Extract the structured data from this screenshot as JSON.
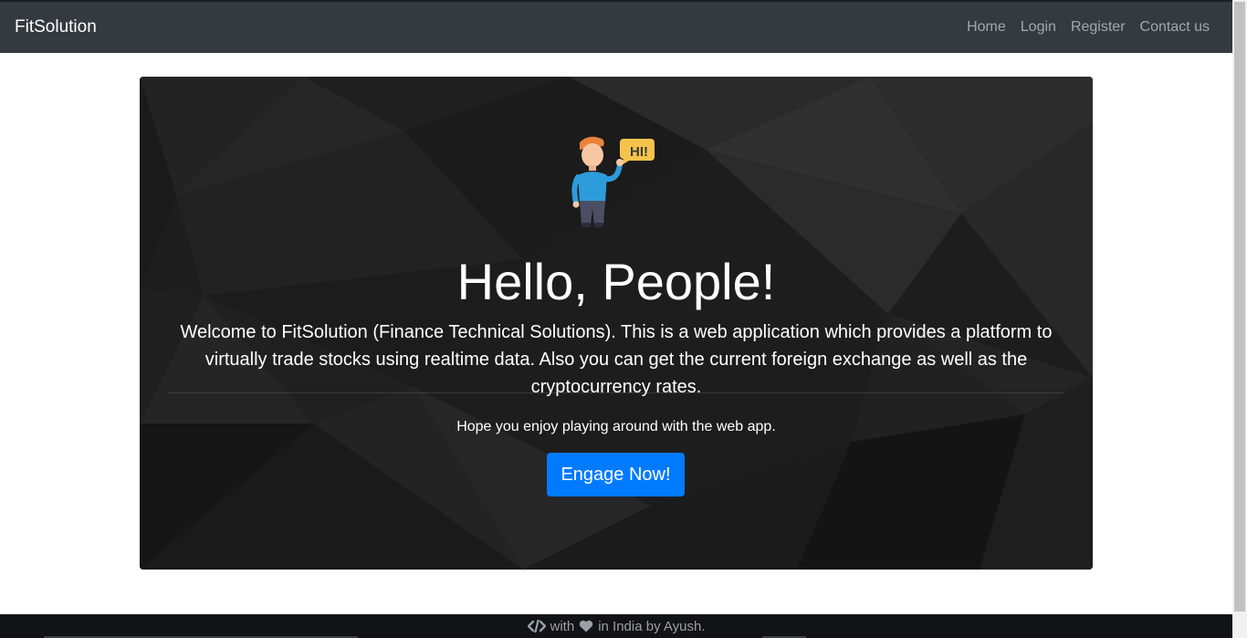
{
  "navbar": {
    "brand": "FitSolution",
    "links": [
      {
        "label": "Home"
      },
      {
        "label": "Login"
      },
      {
        "label": "Register"
      },
      {
        "label": "Contact us"
      }
    ]
  },
  "hero": {
    "heading": "Hello, People!",
    "lead": "Welcome to FitSolution (Finance Technical Solutions). This is a web application which provides a platform to virtually trade stocks using realtime data. Also you can get the current foreign exchange as well as the cryptocurrency rates.",
    "subtext": "Hope you enjoy playing around with the web app.",
    "button_label": "Engage Now!",
    "mascot_bubble": "HI!",
    "button_color": "#007bff"
  },
  "footer": {
    "code_icon": "code-icon",
    "with_text": "with",
    "heart_icon": "heart-icon",
    "tail_text": "in India by Ayush."
  }
}
